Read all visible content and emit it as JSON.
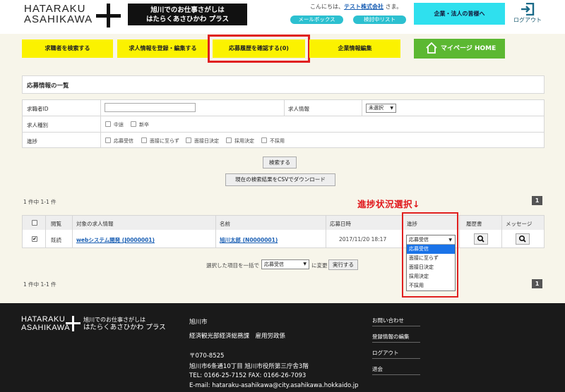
{
  "header": {
    "logo_line1": "HATARAKU",
    "logo_line2": "ASAHIKAWA",
    "tagline_line1": "旭川でのお仕事さがしは",
    "tagline_line2": "はたらくあさひかわ プラス",
    "greeting_prefix": "こんにちは、",
    "company_name": "テスト株式会社",
    "greeting_suffix": " さま。",
    "mailbox": "メールボックス",
    "checklist": "検討中リスト",
    "corp_button": "企業・法人の皆様へ",
    "logout": "ログアウト"
  },
  "nav": {
    "items": [
      {
        "label": "求職者を検索する"
      },
      {
        "label": "求人情報を登録・編集する"
      },
      {
        "label": "応募履歴を確認する(0)"
      },
      {
        "label": "企業情報編集"
      }
    ],
    "mypage": "マイページ HOME"
  },
  "main": {
    "section_title": "応募情報の一覧",
    "filters": {
      "seeker_id_label": "求職者ID",
      "seeker_id_value": "",
      "job_info_label": "求人情報",
      "job_info_select": "未選択",
      "job_type_label": "求人種別",
      "job_types": [
        "中途",
        "新卒"
      ],
      "progress_label": "進捗",
      "progress_options": [
        "応募受信",
        "面接に至らず",
        "面接日決定",
        "採用決定",
        "不採用"
      ]
    },
    "search_button": "検索する",
    "csv_button": "現在の検索結果をCSVでダウンロード",
    "count_top": "1 件中 1-1 件",
    "count_bottom": "1 件中 1-1 件",
    "page_number": "1",
    "annotation": "進捗状況選択↓",
    "table": {
      "headers": [
        "",
        "閲覧",
        "対象の求人情報",
        "名前",
        "応募日時",
        "進捗",
        "履歴書",
        "メッセージ"
      ],
      "rows": [
        {
          "checked": "✔",
          "viewed": "既読",
          "job": "webシステム開発 (J0000001)",
          "name": "旭川太郎 (N0000001)",
          "date": "2017/11/20 18:17",
          "status": "応募受信"
        }
      ]
    },
    "status_dropdown": {
      "current": "応募受信",
      "options": [
        "応募受信",
        "面接に至らず",
        "面接日決定",
        "採用決定",
        "不採用"
      ],
      "highlighted": "応募受信"
    },
    "bulk": {
      "prefix": "選択した項目を一括で",
      "select_value": "応募受信",
      "suffix": "に変更",
      "execute": "実行する"
    }
  },
  "footer": {
    "logo_line1": "HATARAKU",
    "logo_line2": "ASAHIKAWA",
    "tag_line1": "旭川でのお仕事さがしは",
    "tag_line2": "はたらくあさひかわ プラス",
    "org": "旭川市",
    "dept": "経済観光部経済総務課　雇用労政係",
    "postal": "〒070-8525",
    "address": "旭川市6条通10丁目 旭川市役所第三庁舎3階",
    "tel": "TEL: 0166-25-7152 FAX: 0166-26-7093",
    "email": "E-mail: hataraku-asahikawa@city.asahikawa.hokkaido.jp",
    "links": [
      "お問い合わせ",
      "登録情報の編集",
      "ログアウト",
      "退会"
    ]
  },
  "colors": {
    "nav_yellow": "#fbf200",
    "accent_red": "#e02020",
    "mypage_green": "#5cb832",
    "pill_cyan": "#2cc0d0",
    "corp_cyan": "#2fe0ee",
    "footer_bg": "#1a1a1a",
    "link_blue": "#1a5fb4"
  }
}
